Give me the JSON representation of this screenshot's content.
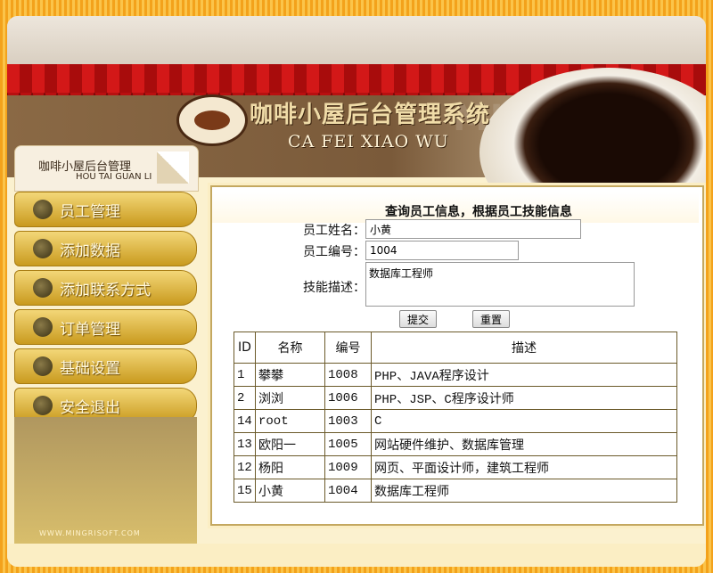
{
  "header": {
    "title": "咖啡小屋后台管理系统",
    "subtitle": "CA FEI XIAO WU",
    "watermark": "MINGRISOFT"
  },
  "sidebar": {
    "title": "咖啡小屋后台管理",
    "pinyin": "HOU TAI GUAN LI",
    "items": [
      {
        "label": "员工管理"
      },
      {
        "label": "添加数据"
      },
      {
        "label": "添加联系方式"
      },
      {
        "label": "订单管理"
      },
      {
        "label": "基础设置"
      },
      {
        "label": "安全退出"
      }
    ],
    "footer_url": "WWW.MINGRISOFT.COM"
  },
  "form": {
    "heading": "查询员工信息，根据员工技能信息",
    "name_label": "员工姓名：",
    "name_value": "小黄",
    "id_label": "员工编号：",
    "id_value": "1004",
    "skill_label": "技能描述：",
    "skill_value": "数据库工程师",
    "submit_label": "提交",
    "reset_label": "重置"
  },
  "table": {
    "headers": [
      "ID",
      "名称",
      "编号",
      "描述"
    ],
    "rows": [
      [
        "1",
        "攀攀",
        "1008",
        "PHP、JAVA程序设计"
      ],
      [
        "2",
        "浏浏",
        "1006",
        "PHP、JSP、C程序设计师"
      ],
      [
        "14",
        "root",
        "1003",
        "C"
      ],
      [
        "13",
        "欧阳一",
        "1005",
        "网站硬件维护、数据库管理"
      ],
      [
        "12",
        "杨阳",
        "1009",
        "网页、平面设计师，建筑工程师"
      ],
      [
        "15",
        "小黄",
        "1004",
        "数据库工程师"
      ]
    ]
  },
  "colors": {
    "awning_red": "#d31818",
    "menu_gold": "#c99a1e",
    "banner_brown": "#7a5a3a"
  }
}
